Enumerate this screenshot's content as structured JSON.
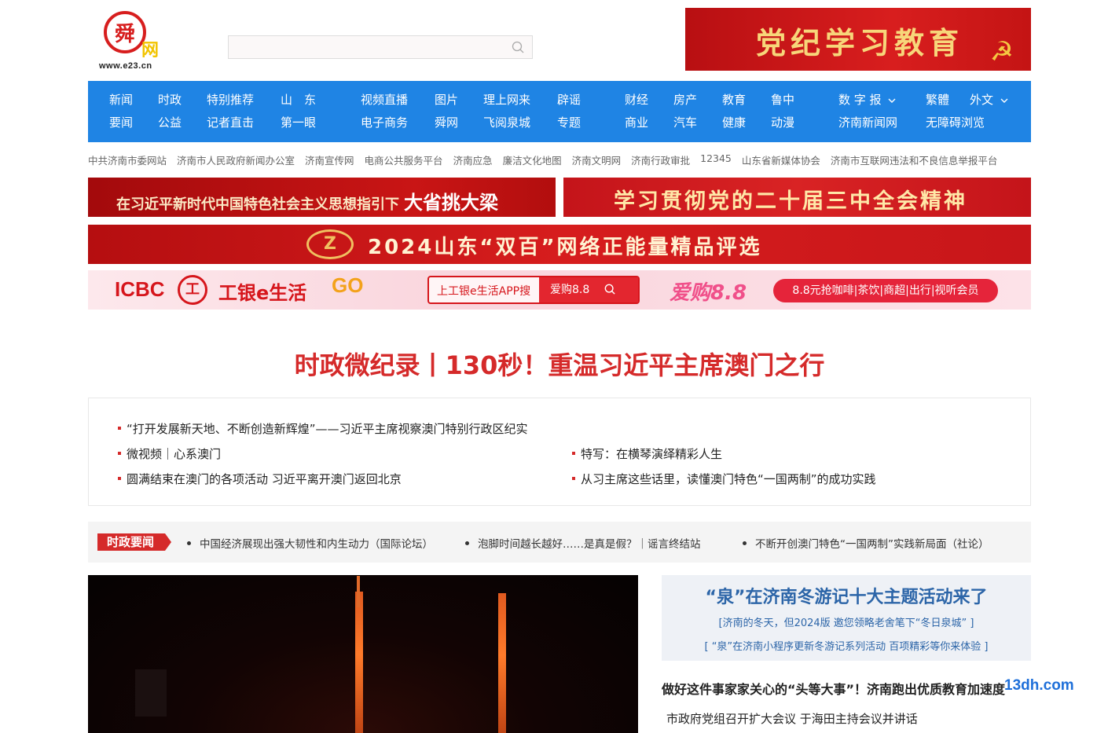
{
  "logo": {
    "glyph": "舜",
    "wang": "网",
    "url": "www.e23.cn"
  },
  "search": {
    "placeholder": ""
  },
  "top_banner": {
    "text": "党纪学习教育",
    "emblem": "☭"
  },
  "nav": {
    "row1": [
      "新闻",
      "时政",
      "特别推荐",
      "山　东",
      "视频直播",
      "图片",
      "理上网来",
      "辟谣",
      "财经",
      "房产",
      "教育",
      "鲁中",
      "数 字 报",
      "繁體",
      "外文"
    ],
    "row2": [
      "要闻",
      "公益",
      "记者直击",
      "第一眼",
      "电子商务",
      "舜网",
      "飞阅泉城",
      "专题",
      "商业",
      "汽车",
      "健康",
      "动漫",
      "济南新闻网",
      "无障碍浏览"
    ]
  },
  "links": [
    "中共济南市委网站",
    "济南市人民政府新闻办公室",
    "济南宣传网",
    "电商公共服务平台",
    "济南应急",
    "廉洁文化地图",
    "济南文明网",
    "济南行政审批",
    "12345",
    "山东省新媒体协会",
    "济南市互联网违法和不良信息举报平台"
  ],
  "banners": {
    "b1_small": "在习近平新时代中国特色社会主义思想指引下",
    "b1_big": "大省挑大梁",
    "b2": "学习贯彻党的二十届三中全会精神",
    "b3": "2024山东“双百”网络正能量精品评选",
    "b4": {
      "icbc": "ICBC",
      "seal": "工",
      "life": "工银e生活",
      "go": "GO",
      "search_left": "上工银e生活APP搜",
      "search_right": "爱购8.8",
      "aigou": "爱购8.8",
      "promo": "8.8元抢咖啡|茶饮|商超|出行|视听会员"
    }
  },
  "headline": "时政微纪录丨130秒！重温习近平主席澳门之行",
  "related": [
    "“打开发展新天地、不断创造新辉煌”——习近平主席视察澳门特别行政区纪实",
    "微视频｜心系澳门",
    "特写：在横琴演绎精彩人生",
    "圆满结束在澳门的各项活动 习近平离开澳门返回北京",
    "从习主席这些话里，读懂澳门特色“一国两制”的成功实践"
  ],
  "ticker": {
    "tag": "时政要闻",
    "items": [
      "中国经济展现出强大韧性和内生动力（国际论坛）",
      "泡脚时间越长越好……是真是假？｜谣言终结站",
      "不断开创澳门特色“一国两制”实践新局面（社论）"
    ]
  },
  "feature": {
    "title": "“泉”在济南冬游记十大主题活动来了",
    "sub1": "[济南的冬天，但2024版 邀您领略老舍笔下“冬日泉城” ]",
    "sub2": "[ “泉”在济南小程序更新冬游记系列活动 百项精彩等你来体验 ]"
  },
  "news": [
    "做好这件事家家关心的“头等大事”！济南跑出优质教育加速度",
    "市政府党组召开扩大会议 于海田主持会议并讲话"
  ],
  "watermark": "13dh.com"
}
